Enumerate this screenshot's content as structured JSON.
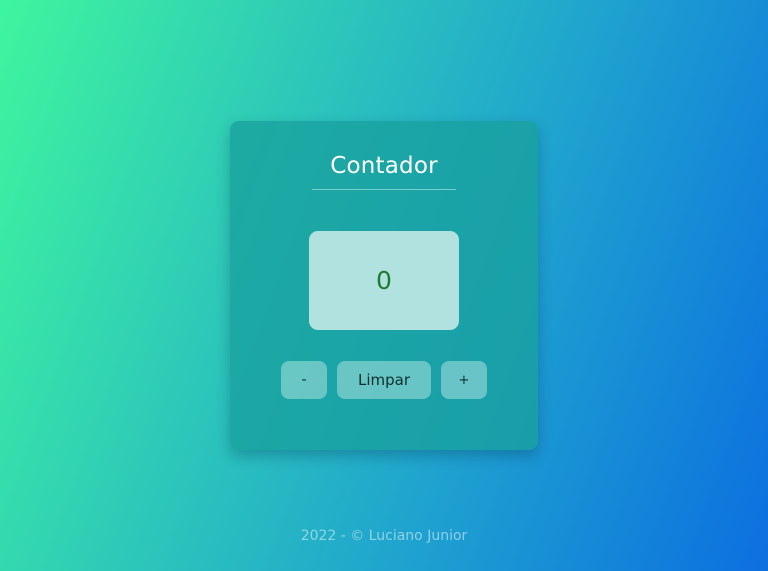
{
  "counter": {
    "title": "Contador",
    "value": "0",
    "buttons": {
      "decrement_label": "-",
      "clear_label": "Limpar",
      "increment_label": "+"
    }
  },
  "footer": {
    "text": "2022 - © Luciano Junior"
  },
  "colors": {
    "gradient_start": "#3ff59e",
    "gradient_end": "#0c6fe0",
    "card_background": "#18a09e",
    "display_background": "#b2e2e0",
    "counter_text": "#1e7d2c"
  }
}
